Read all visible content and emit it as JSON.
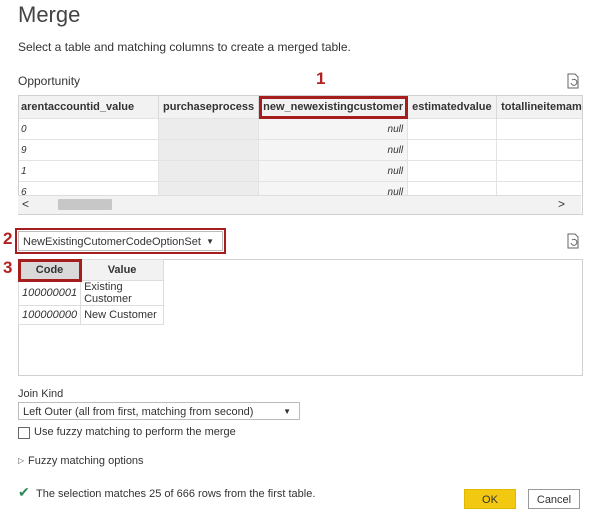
{
  "dialog": {
    "title": "Merge",
    "subtitle": "Select a table and matching columns to create a merged table."
  },
  "table1": {
    "name": "Opportunity",
    "columns": [
      "arentaccountid_value",
      "purchaseprocess",
      "new_newexistingcustomer",
      "estimatedvalue",
      "totallineitemamount"
    ],
    "row_prefixes": [
      "0",
      "9",
      "1",
      "6"
    ],
    "null_text": "null",
    "scroll_left": "<",
    "scroll_right": ">"
  },
  "annotations": {
    "n1": "1",
    "n2": "2",
    "n3": "3"
  },
  "table2_select": {
    "value": "NewExistingCutomerCodeOptionSet"
  },
  "table2": {
    "headers": [
      "Code",
      "Value"
    ],
    "rows": [
      [
        "100000001",
        "Existing Customer"
      ],
      [
        "100000000",
        "New Customer"
      ]
    ]
  },
  "join": {
    "label": "Join Kind",
    "value": "Left Outer (all from first, matching from second)"
  },
  "fuzzy": {
    "checkbox_label": "Use fuzzy matching to perform the merge",
    "options_label": "Fuzzy matching options"
  },
  "status": {
    "text": "The selection matches 25 of 666 rows from the first table."
  },
  "buttons": {
    "ok": "OK",
    "cancel": "Cancel"
  },
  "colors": {
    "highlight": "#a51d1d",
    "ok": "#f2c811",
    "check": "#2e8b57"
  }
}
